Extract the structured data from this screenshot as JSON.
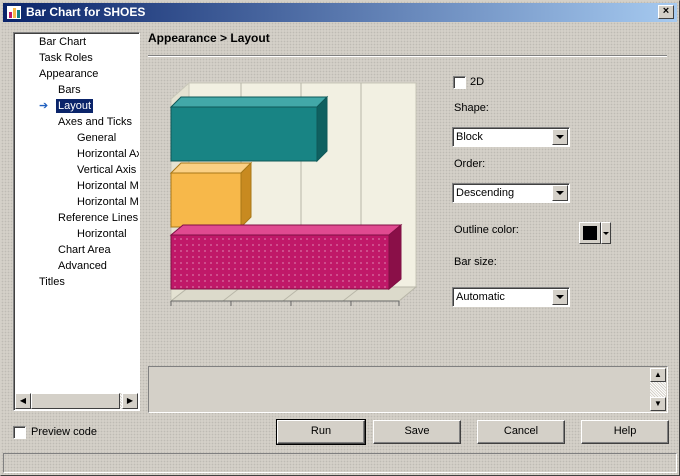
{
  "window": {
    "title": "Bar Chart for SHOES",
    "close_glyph": "×"
  },
  "tree": {
    "items": [
      {
        "label": "Bar Chart"
      },
      {
        "label": "Task Roles"
      },
      {
        "label": "Appearance"
      },
      {
        "label": "Bars"
      },
      {
        "label": "Layout",
        "selected": true
      },
      {
        "label": "Axes and Ticks"
      },
      {
        "label": "General"
      },
      {
        "label": "Horizontal Axis"
      },
      {
        "label": "Vertical Axis"
      },
      {
        "label": "Horizontal Major"
      },
      {
        "label": "Horizontal Minor"
      },
      {
        "label": "Reference Lines"
      },
      {
        "label": "Horizontal"
      },
      {
        "label": "Chart Area"
      },
      {
        "label": "Advanced"
      },
      {
        "label": "Titles"
      }
    ]
  },
  "breadcrumb": "Appearance > Layout",
  "preview": {
    "bar_colors": [
      "#188484",
      "#f7b84a",
      "#c01868"
    ],
    "wall_color": "#f2f0e2"
  },
  "options": {
    "two_d_label": "2D",
    "two_d_checked": false,
    "shape_label": "Shape:",
    "shape_value": "Block",
    "order_label": "Order:",
    "order_value": "Descending",
    "outline_label": "Outline color:",
    "outline_color": "#000000",
    "barsize_label": "Bar size:",
    "barsize_value": "Automatic"
  },
  "footer": {
    "preview_code_label": "Preview code",
    "preview_code_checked": false,
    "run": "Run",
    "save": "Save",
    "cancel": "Cancel",
    "help": "Help"
  }
}
